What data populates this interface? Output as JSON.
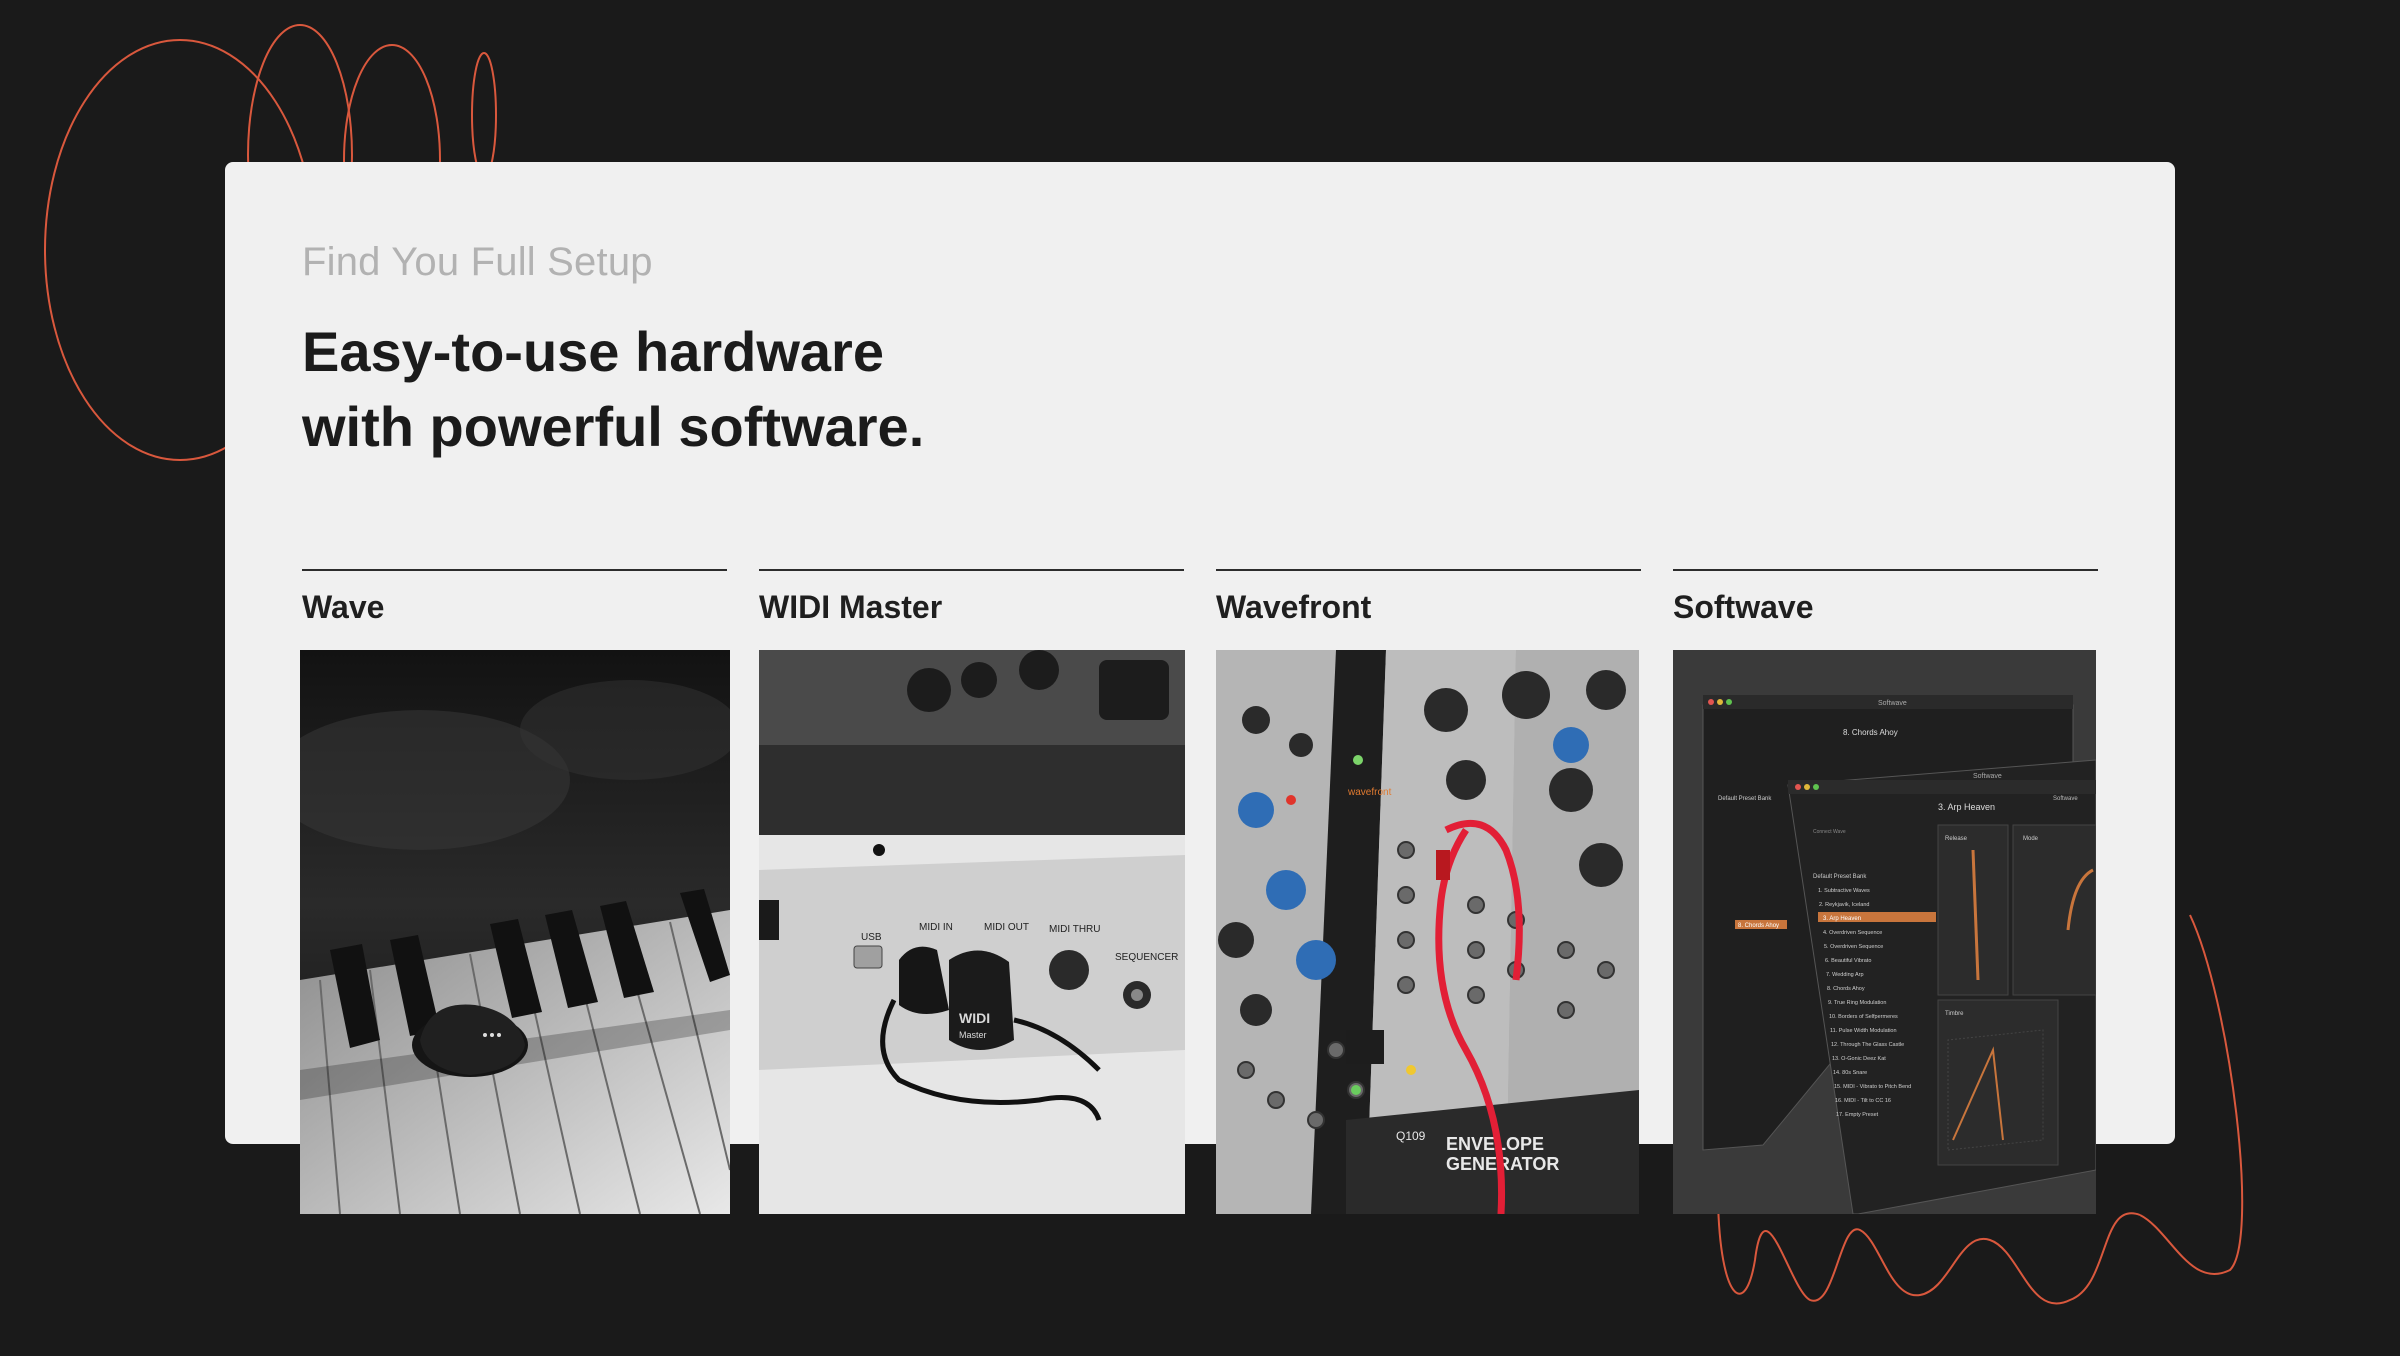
{
  "section": {
    "eyebrow": "Find You Full Setup",
    "headline_line1": "Easy-to-use hardware",
    "headline_line2": "with powerful software."
  },
  "products": [
    {
      "name": "Wave"
    },
    {
      "name": "WIDI Master"
    },
    {
      "name": "Wavefront"
    },
    {
      "name": "Softwave"
    }
  ],
  "widi_labels": {
    "usb": "USB",
    "midi_in": "MIDI IN",
    "midi_out": "MIDI OUT",
    "midi_thru": "MIDI THRU",
    "sequencer": "SEQUENCER",
    "brand_line1": "WIDI",
    "brand_line2": "Master"
  },
  "wavefront_labels": {
    "brand": "wavefront",
    "module_id": "Q109",
    "module_line1": "ENVELOPE",
    "module_line2": "GENERATOR"
  },
  "softwave_app": {
    "window_title": "Softwave",
    "header_label": "Softwave",
    "back_preset": "8. Chords Ahoy",
    "front_preset": "3. Arp Heaven",
    "bank_title": "Default Preset Bank",
    "param_release": "Release",
    "param_mode": "Mode",
    "param_timbre": "Timbre",
    "connect_wave": "Connect Wave",
    "presets": [
      "1. Subtractive Waves",
      "2. Reykjavik, Iceland",
      "3. Arp Heaven",
      "4. Overdriven Sequence",
      "5. Overdriven Sequence",
      "6. Beautiful Vibrato",
      "7. Wedding Arp",
      "8. Chords Ahoy",
      "9. True Ring Modulation",
      "10. Borders of Selfpermeres",
      "11. Pulse Width Modulation",
      "12. Through The Glass Castle",
      "13. O-Gonic Deez Kat",
      "14. 80s Snare",
      "15. MIDI - Vibrato to Pitch Bend",
      "16. MIDI - Tilt to CC 16",
      "17. Empty Preset"
    ]
  },
  "colors": {
    "background": "#1a1a1a",
    "card": "#f0f0f0",
    "accent": "#e05a3c",
    "app_highlight": "#c8753c"
  }
}
